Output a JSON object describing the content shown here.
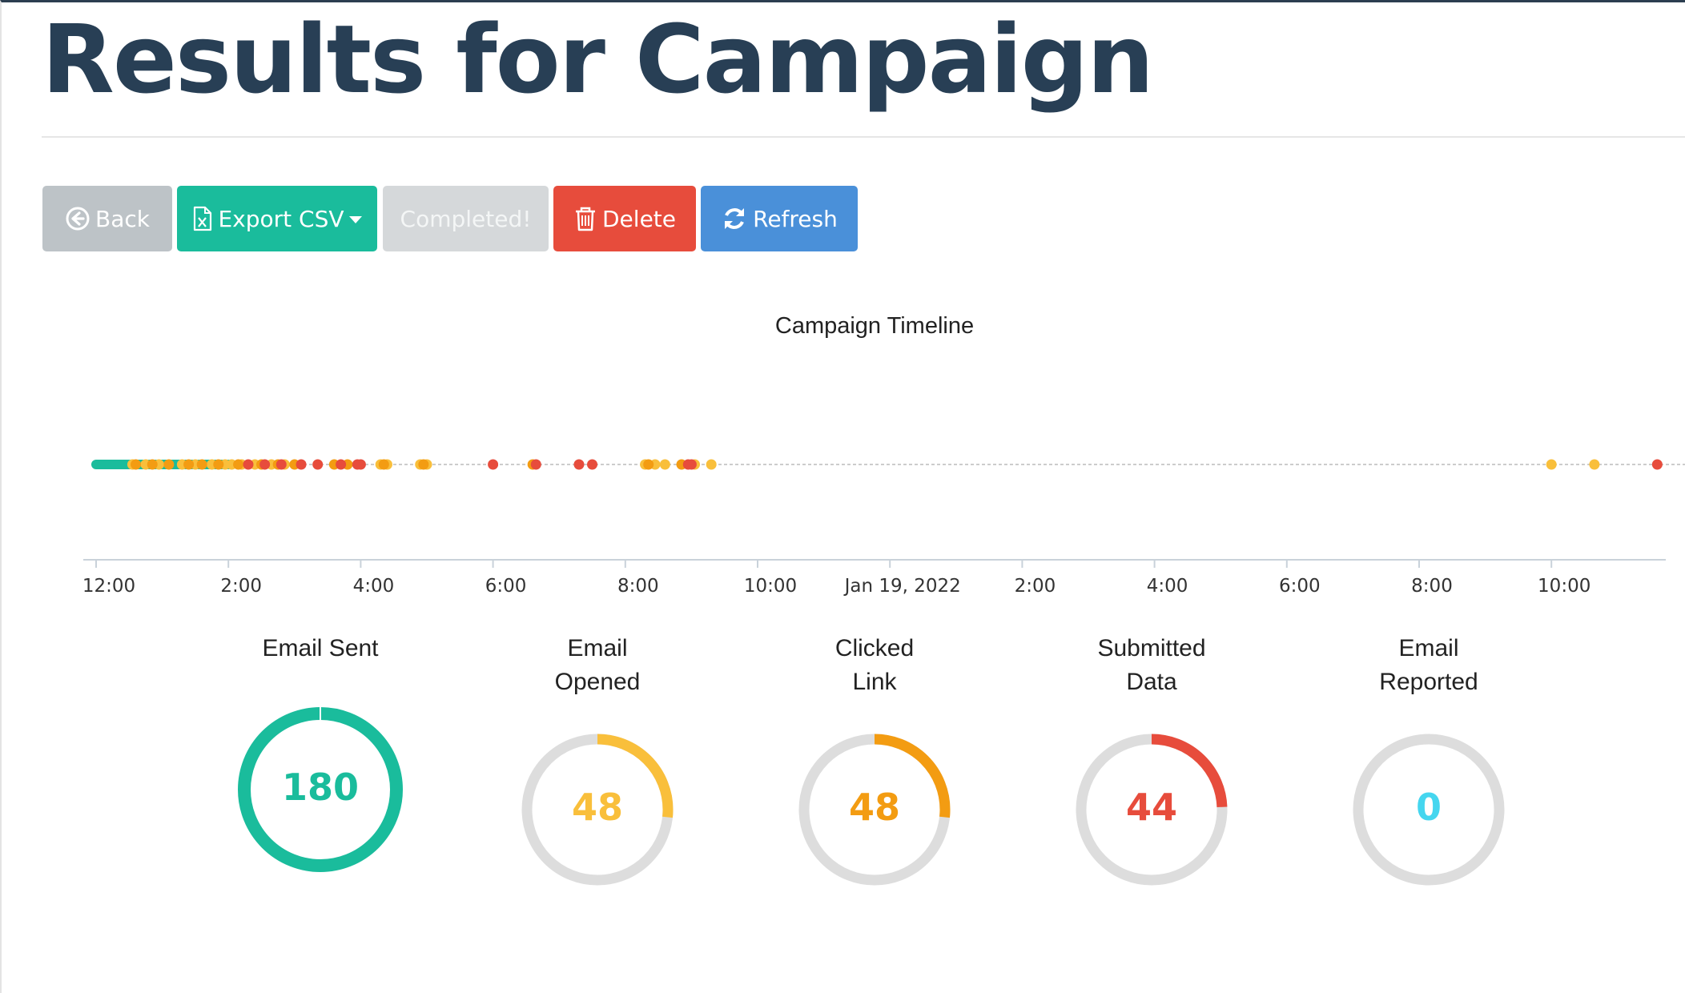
{
  "page": {
    "title": "Results for Campaign"
  },
  "toolbar": {
    "back_label": "Back",
    "export_label": "Export CSV",
    "completed_label": "Completed!",
    "delete_label": "Delete",
    "refresh_label": "Refresh"
  },
  "colors": {
    "sent": "#1abc9c",
    "opened": "#f9bf3b",
    "clicked": "#f39c12",
    "submitted": "#e74c3c",
    "reported": "#45d6ef",
    "track": "#dddddd",
    "title": "#283f55"
  },
  "icons": {
    "back": "circle-arrow-left-icon",
    "export": "excel-file-icon",
    "delete": "trash-icon",
    "refresh": "refresh-icon"
  },
  "chart_data": {
    "type": "scatter",
    "title": "Campaign Timeline",
    "x_unit": "hours",
    "xlim": [
      0,
      35.6
    ],
    "tick_labels": [
      "12:00",
      "2:00",
      "4:00",
      "6:00",
      "8:00",
      "10:00",
      "Jan 19, 2022",
      "2:00",
      "4:00",
      "6:00",
      "8:00",
      "10:00"
    ],
    "tick_values": [
      0,
      2,
      4,
      6,
      8,
      10,
      12,
      14,
      16,
      18,
      20,
      22
    ],
    "series": [
      {
        "key": "sent",
        "x_range": [
          0,
          2.0
        ]
      },
      {
        "key": "opened",
        "x": [
          0.55,
          0.75,
          0.95,
          1.3,
          1.5,
          1.75,
          1.95,
          2.05,
          2.2,
          2.4,
          2.65,
          2.85,
          4.3,
          4.4,
          4.9,
          5.0,
          8.3,
          8.45,
          8.6,
          9.05,
          9.3,
          22.0,
          22.65
        ]
      },
      {
        "key": "clicked",
        "x": [
          0.6,
          0.85,
          1.1,
          1.4,
          1.6,
          1.85,
          2.15,
          2.5,
          2.75,
          3.0,
          3.6,
          3.8,
          4.35,
          4.95,
          6.6,
          8.35,
          8.85
        ]
      },
      {
        "key": "submitted",
        "x": [
          2.3,
          2.55,
          2.8,
          3.1,
          3.35,
          3.7,
          3.95,
          4.0,
          6.0,
          6.65,
          7.3,
          7.5,
          8.95,
          9.0,
          23.6
        ]
      }
    ]
  },
  "stats": [
    {
      "key": "sent",
      "label": "Email Sent",
      "value": "180",
      "fraction": 1.0
    },
    {
      "key": "opened",
      "label": "Email\nOpened",
      "value": "48",
      "fraction": 0.267
    },
    {
      "key": "clicked",
      "label": "Clicked\nLink",
      "value": "48",
      "fraction": 0.267
    },
    {
      "key": "submitted",
      "label": "Submitted\nData",
      "value": "44",
      "fraction": 0.244
    },
    {
      "key": "reported",
      "label": "Email\nReported",
      "value": "0",
      "fraction": 0.0
    }
  ]
}
